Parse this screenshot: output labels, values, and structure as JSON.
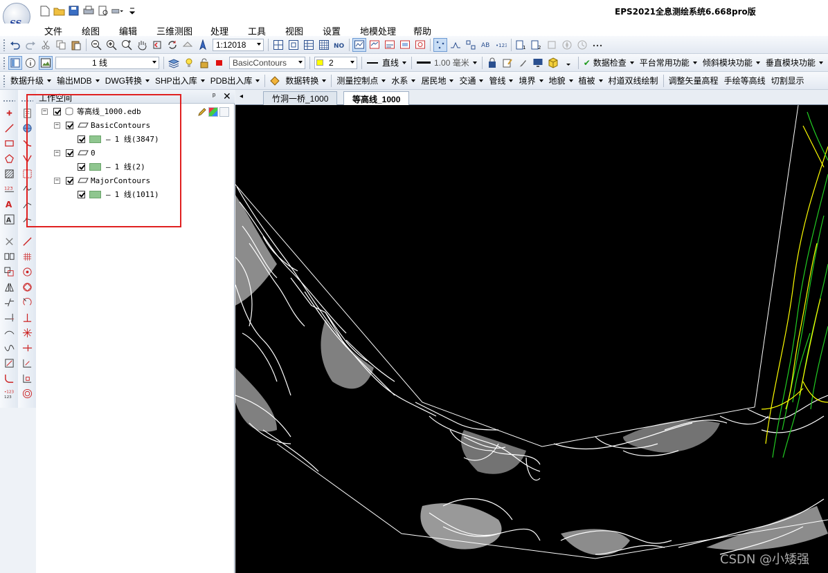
{
  "app": {
    "title": "EPS2021全息测绘系统6.668pro版",
    "logo_text": "SS"
  },
  "menu": [
    "文件",
    "绘图",
    "编辑",
    "三维测图",
    "处理",
    "工具",
    "视图",
    "设置",
    "地模处理",
    "帮助"
  ],
  "toolbar1": {
    "scale": "1:12018"
  },
  "toolbar2": {
    "line_type": "1 线",
    "layer": "BasicContours",
    "color_index": "2",
    "line_style": "直线",
    "line_width": "1.00 毫米",
    "data_check": "数据检查",
    "platform_functions": "平台常用功能",
    "oblique_module": "倾斜模块功能",
    "vertical_module": "垂直模块功能"
  },
  "toolbar3": [
    "数据升级",
    "输出MDB",
    "DWG转换",
    "SHP出入库",
    "PDB出入库",
    "数据转换",
    "测量控制点",
    "水系",
    "居民地",
    "交通",
    "管线",
    "境界",
    "地貌",
    "植被",
    "村道双线绘制",
    "调整矢量高程",
    "手绘等高线",
    "切割显示"
  ],
  "workspace": {
    "title": "工作空间",
    "pin": "ᵖ",
    "close": "✕",
    "tree": {
      "database": "等高线_1000.edb",
      "layers": [
        {
          "name": "BasicContours",
          "item": "1 线(3847)"
        },
        {
          "name": "0",
          "item": "1 线(2)"
        },
        {
          "name": "MajorContours",
          "item": "1 线(1011)"
        }
      ]
    }
  },
  "tabs": {
    "nav": "◂",
    "items": [
      {
        "label": "竹洞一桥_1000",
        "active": false
      },
      {
        "label": "等高线_1000",
        "active": true
      }
    ]
  },
  "watermark": "CSDN @小矮强",
  "colors": {
    "map_background": "#000000",
    "contour_white": "#ffffff",
    "contour_green": "#22cc22",
    "contour_yellow": "#ffff00",
    "highlight_box": "#e02020",
    "layer_swatch": "#8fc68f"
  }
}
